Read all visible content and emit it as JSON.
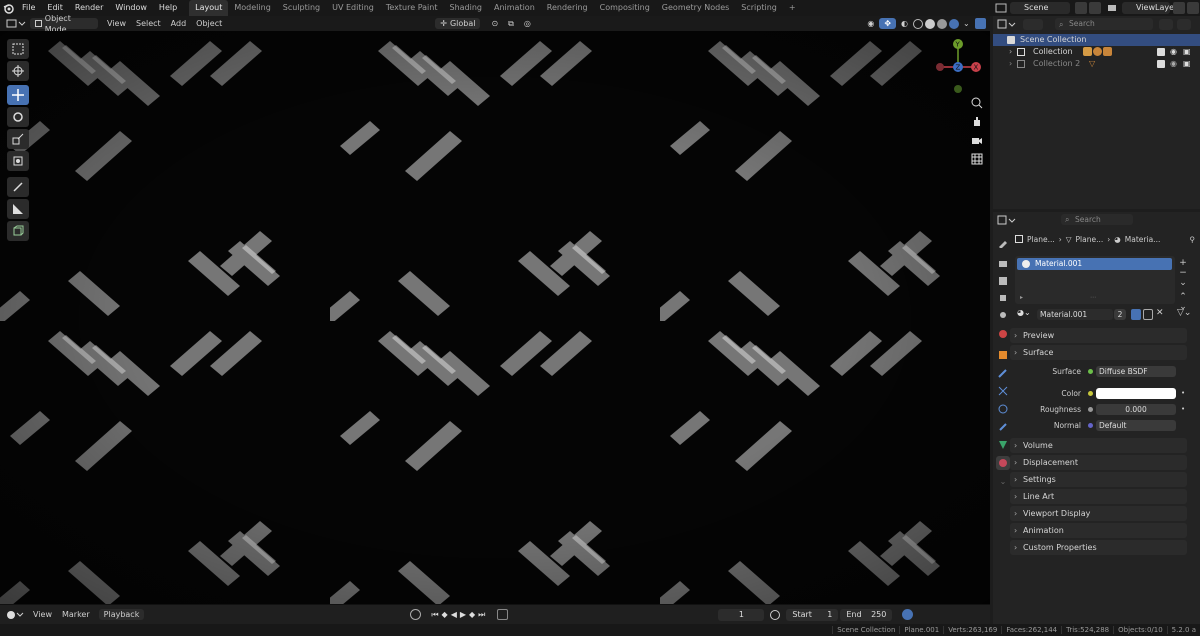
{
  "menus": [
    "File",
    "Edit",
    "Render",
    "Window",
    "Help"
  ],
  "workspaces": [
    "Layout",
    "Modeling",
    "Sculpting",
    "UV Editing",
    "Texture Paint",
    "Shading",
    "Animation",
    "Rendering",
    "Compositing",
    "Geometry Nodes",
    "Scripting"
  ],
  "active_workspace": "Layout",
  "scene": "Scene",
  "view_layer": "ViewLayer",
  "viewport_header": {
    "mode": "Object Mode",
    "menus": [
      "View",
      "Select",
      "Add",
      "Object"
    ],
    "transform_orientation": "Global"
  },
  "gizmo": {
    "y": "Y",
    "z": "Z",
    "x": "X"
  },
  "outliner": {
    "search_placeholder": "Search",
    "rows": [
      {
        "label": "Scene Collection"
      },
      {
        "label": "Collection"
      },
      {
        "label": "Collection 2"
      }
    ]
  },
  "properties": {
    "search_placeholder": "Search",
    "breadcrumb": [
      "Plane...",
      "Plane...",
      "Materia..."
    ],
    "material_slot": "Material.001",
    "material_name": "Material.001",
    "users": "2",
    "panels_top": [
      "Preview",
      "Surface"
    ],
    "surface": {
      "surface_label": "Surface",
      "surface_value": "Diffuse BSDF",
      "color_label": "Color",
      "roughness_label": "Roughness",
      "roughness_value": "0.000",
      "normal_label": "Normal",
      "normal_value": "Default"
    },
    "panels": [
      "Volume",
      "Displacement",
      "Settings",
      "Line Art",
      "Viewport Display",
      "Animation",
      "Custom Properties"
    ]
  },
  "timeline": {
    "menus": [
      "View",
      "Marker",
      "Playback"
    ],
    "current_frame": "1",
    "start_label": "Start",
    "start": "1",
    "end_label": "End",
    "end": "250"
  },
  "status": [
    "Scene Collection",
    "Plane.001",
    "Verts:263,169",
    "Faces:262,144",
    "Tris:524,288",
    "Objects:0/10",
    "5.2.0 a"
  ]
}
